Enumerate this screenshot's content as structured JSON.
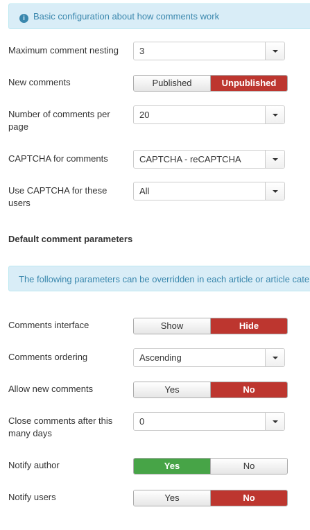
{
  "info1": {
    "icon": "info-icon",
    "text": "Basic configuration about how comments work"
  },
  "fields1": {
    "nesting": {
      "label": "Maximum comment nesting",
      "value": "3"
    },
    "new_comments": {
      "label": "New comments",
      "options": [
        "Published",
        "Unpublished"
      ],
      "selected": "Unpublished"
    },
    "per_page": {
      "label": "Number of comments per page",
      "value": "20"
    },
    "captcha": {
      "label": "CAPTCHA for comments",
      "value": "CAPTCHA - reCAPTCHA"
    },
    "captcha_users": {
      "label": "Use CAPTCHA for these users",
      "value": "All"
    }
  },
  "section": {
    "title": "Default comment parameters"
  },
  "info2": {
    "text": "The following parameters can be overridden in each article or article cate"
  },
  "fields2": {
    "interface": {
      "label": "Comments interface",
      "options": [
        "Show",
        "Hide"
      ],
      "selected": "Hide"
    },
    "ordering": {
      "label": "Comments ordering",
      "value": "Ascending"
    },
    "allow_new": {
      "label": "Allow new comments",
      "options": [
        "Yes",
        "No"
      ],
      "selected": "No"
    },
    "close_after": {
      "label": "Close comments after this many days",
      "value": "0"
    },
    "notify_author": {
      "label": "Notify author",
      "options": [
        "Yes",
        "No"
      ],
      "selected": "Yes"
    },
    "notify_users": {
      "label": "Notify users",
      "options": [
        "Yes",
        "No"
      ],
      "selected": "No"
    }
  },
  "colors": {
    "info_bg": "#d9edf7",
    "info_text": "#3a87ad",
    "danger": "#bd362f",
    "success": "#47a447"
  }
}
